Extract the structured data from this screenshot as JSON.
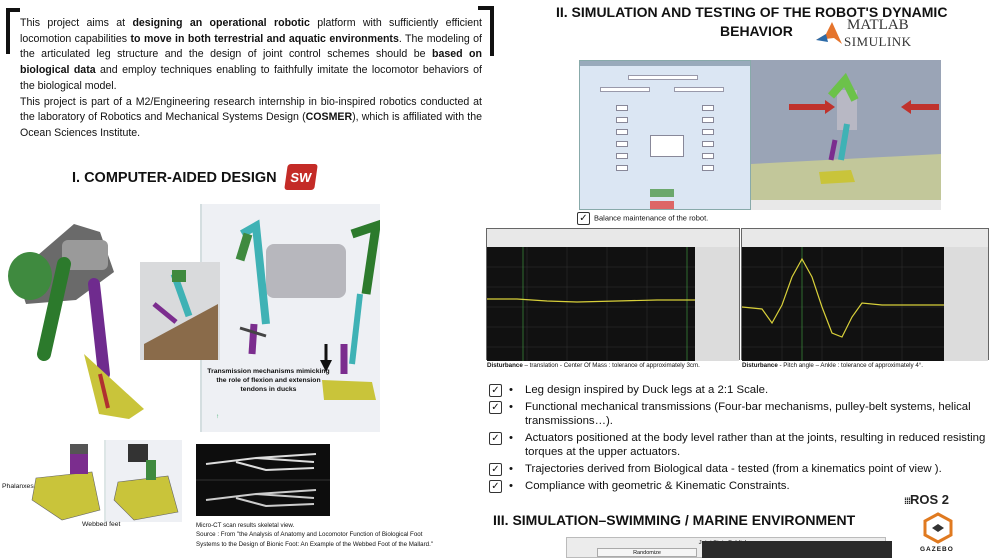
{
  "intro": {
    "p1_a": "This project aims at ",
    "p1_b": "designing an operational robotic",
    "p1_c": " platform with sufficiently efficient locomotion capabilities ",
    "p1_d": "to move in both terrestrial and aquatic environments",
    "p1_e": ". The modeling of the articulated leg structure and the design of joint control schemes should be ",
    "p1_f": "based on biological data",
    "p1_g": " and employ techniques enabling to faithfully imitate the locomotor behaviors of the biological model.",
    "p2_a": "This project is part of a M2/Engineering research internship in bio-inspired robotics conducted at the laboratory of Robotics and Mechanical Systems Design (",
    "p2_b": "COSMER",
    "p2_c": "), which is affiliated with the Ocean Sciences Institute."
  },
  "section1": {
    "title": "I. COMPUTER-AIDED DESIGN",
    "logo_text": "SW"
  },
  "cad": {
    "transmission_note": "Transmission mechanisms mimicking the role of flexion and extension tendons in ducks",
    "phalanxes_label": "Phalanxes",
    "webbed_label": "Webbed feet",
    "ct_caption_1": "Micro-CT scan results skeletal view.",
    "ct_caption_2": "Source : From \"the Analysis of Anatomy and Locomotor Function of Biological Foot",
    "ct_caption_3": "Systems to the Design of Bionic Foot: An Example of the Webbed Foot of the Mallard.\""
  },
  "section2": {
    "title_line1": "II. SIMULATION AND TESTING OF THE ROBOT'S DYNAMIC",
    "title_line2": "BEHAVIOR",
    "matlab_1": "MATLAB",
    "matlab_2": "SIMULINK"
  },
  "simulation": {
    "balance": "Balance maintenance of the robot.",
    "check_glyph": "✓",
    "caption1_bold": "Disturbance",
    "caption1_rest": " – translation - Center Of Mass : tolerance of approximately 3cm.",
    "caption2_bold": "Disturbance",
    "caption2_rest": " - Pitch angle – Ankle : tolerance of approximately 4°."
  },
  "bullets": [
    "Leg design inspired by Duck legs at a 2:1 Scale.",
    "Functional mechanical transmissions (Four-bar mechanisms, pulley-belt systems, helical transmissions…).",
    "Actuators positioned at the body level rather than at the joints, resulting in reduced resisting torques at the upper actuators.",
    "Trajectories derived from Biological data - tested (from a kinematics point of view ).",
    "Compliance with geometric & Kinematic Constraints."
  ],
  "section3": {
    "title": "III. SIMULATION–SWIMMING / MARINE ENVIRONMENT",
    "ros": "ROS 2",
    "gazebo": "GAZEBO",
    "jsp_title": "Joint State Publisher",
    "jsp_button": "Randomize"
  },
  "colors": {
    "solidworks_red": "#c42b27",
    "robot_purple": "#7b2d8e",
    "robot_green": "#3f8a3f",
    "robot_cyan": "#3fb2b5",
    "foot_yellow": "#c9c43a"
  }
}
